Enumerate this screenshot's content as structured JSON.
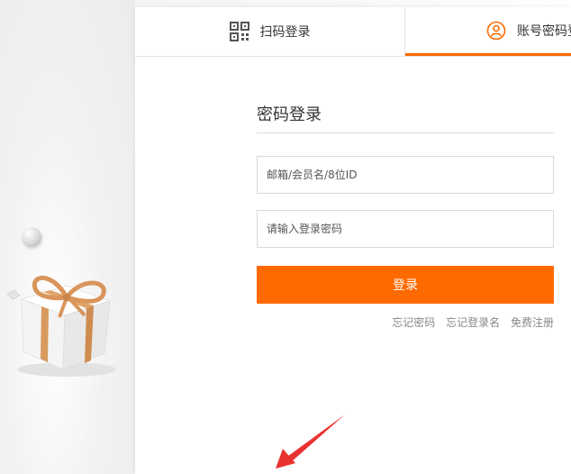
{
  "tabs": {
    "qr_label": "扫码登录",
    "account_label": "账号密码登录"
  },
  "form": {
    "title": "密码登录",
    "username_placeholder": "邮箱/会员名/8位ID",
    "password_placeholder": "请输入登录密码",
    "submit_label": "登录"
  },
  "links": {
    "forgot_password": "忘记密码",
    "forgot_username": "忘记登录名",
    "register": "免费注册"
  },
  "colors": {
    "accent": "#ff6a00",
    "annotation_arrow": "#e8322f"
  },
  "icons": {
    "qr": "qr-code-icon",
    "user": "user-icon"
  }
}
